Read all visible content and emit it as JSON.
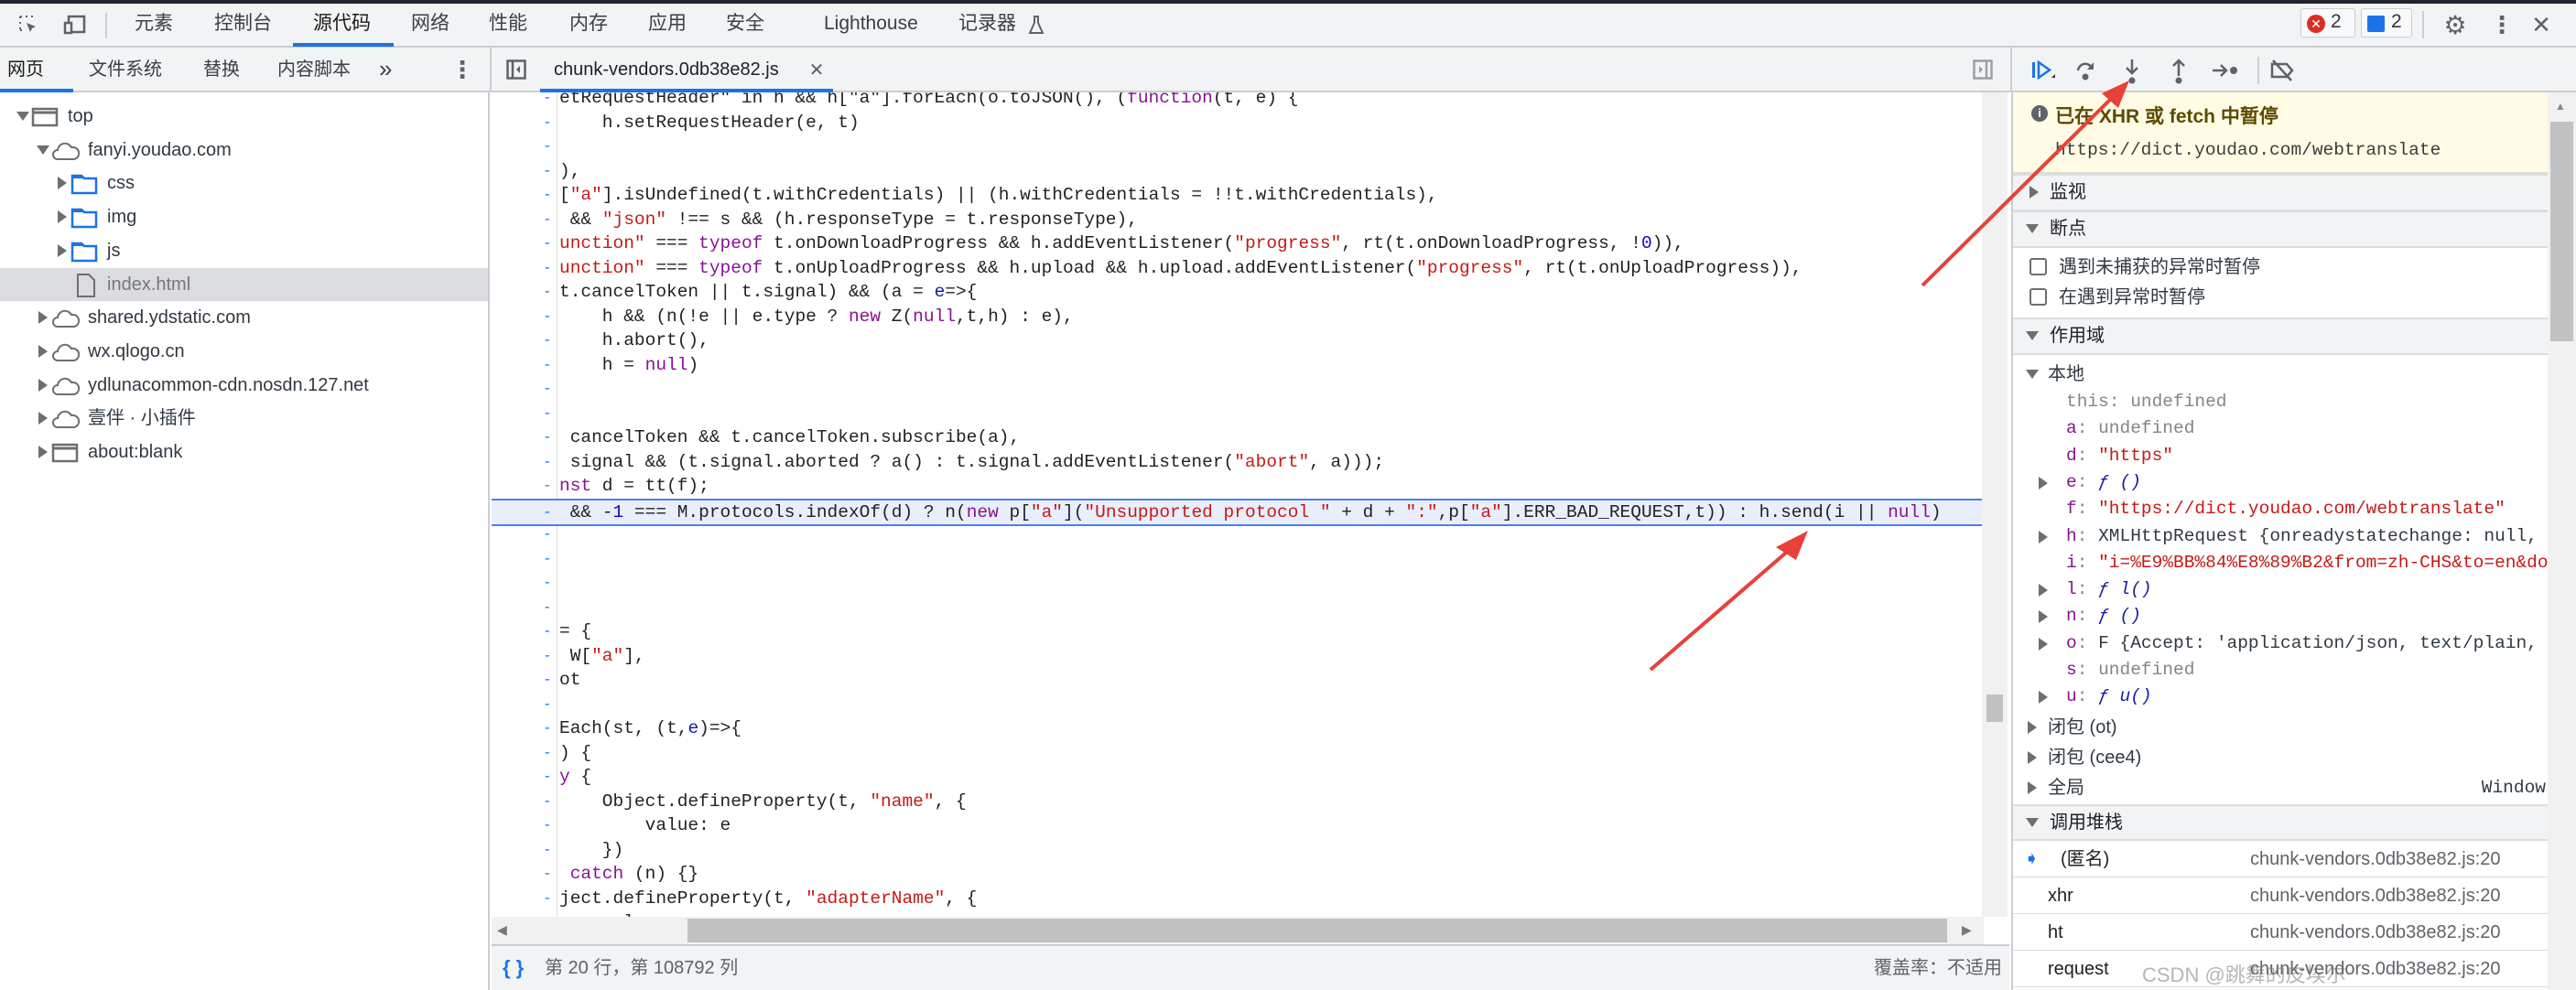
{
  "main_tabs": [
    {
      "label": "元素"
    },
    {
      "label": "控制台"
    },
    {
      "label": "源代码",
      "selected": true
    },
    {
      "label": "网络"
    },
    {
      "label": "性能"
    },
    {
      "label": "内存"
    },
    {
      "label": "应用"
    },
    {
      "label": "安全"
    },
    {
      "label": "Lighthouse"
    },
    {
      "label": "记录器"
    }
  ],
  "badges": {
    "errors": "2",
    "messages": "2",
    "error_color": "#d93025",
    "message_color": "#1a73e8"
  },
  "navigator_tabs": [
    {
      "label": "网页",
      "selected": true
    },
    {
      "label": "文件系统"
    },
    {
      "label": "替换"
    },
    {
      "label": "内容脚本"
    }
  ],
  "more_tabs": "»",
  "file_tab": {
    "name": "chunk-vendors.0db38e82.js"
  },
  "tree": [
    {
      "label": "top",
      "icon": "frame",
      "expanded": true,
      "depth": 0
    },
    {
      "label": "fanyi.youdao.com",
      "icon": "cloud",
      "expanded": true,
      "depth": 1
    },
    {
      "label": "css",
      "icon": "folder",
      "expanded": false,
      "depth": 2
    },
    {
      "label": "img",
      "icon": "folder",
      "expanded": false,
      "depth": 2
    },
    {
      "label": "js",
      "icon": "folder",
      "expanded": false,
      "depth": 2
    },
    {
      "label": "index.html",
      "icon": "file",
      "depth": 2,
      "selected": true
    },
    {
      "label": "shared.ydstatic.com",
      "icon": "cloud",
      "expanded": false,
      "depth": 1
    },
    {
      "label": "wx.qlogo.cn",
      "icon": "cloud",
      "expanded": false,
      "depth": 1
    },
    {
      "label": "ydlunacommon-cdn.nosdn.127.net",
      "icon": "cloud",
      "expanded": false,
      "depth": 1
    },
    {
      "label": "壹伴 · 小插件",
      "icon": "cloud",
      "expanded": false,
      "depth": 1
    },
    {
      "label": "about:blank",
      "icon": "frame",
      "expanded": false,
      "depth": 1
    }
  ],
  "code_lines": [
    [
      [
        "etRequestHeader\" in h && h[\"a\"].forEach(o.toJSON(), (",
        ""
      ],
      [
        "function",
        "k"
      ],
      [
        "(t, e) {",
        ""
      ]
    ],
    [
      [
        "    h.setRequestHeader(e, t)",
        ""
      ]
    ],
    [],
    [
      [
        "),",
        ""
      ]
    ],
    [
      [
        "[",
        ""
      ],
      [
        "\"a\"",
        "s"
      ],
      [
        "].isUndefined(t.withCredentials) || (h.withCredentials = !!t.withCredentials),",
        ""
      ]
    ],
    [
      [
        " && ",
        ""
      ],
      [
        "\"json\"",
        "s"
      ],
      [
        " !== s && (h.responseType = t.responseType),",
        ""
      ]
    ],
    [
      [
        "unction\"",
        "s"
      ],
      [
        " === ",
        ""
      ],
      [
        "typeof",
        "k"
      ],
      [
        " t.onDownloadProgress && h.addEventListener(",
        ""
      ],
      [
        "\"progress\"",
        "s"
      ],
      [
        ", rt(t.onDownloadProgress, !",
        ""
      ],
      [
        "0",
        "n"
      ],
      [
        ")),",
        ""
      ]
    ],
    [
      [
        "unction\"",
        "s"
      ],
      [
        " === ",
        ""
      ],
      [
        "typeof",
        "k"
      ],
      [
        " t.onUploadProgress && h.upload && h.upload.addEventListener(",
        ""
      ],
      [
        "\"progress\"",
        "s"
      ],
      [
        ", rt(t.onUploadProgress)),",
        ""
      ]
    ],
    [
      [
        "t.cancelToken || t.signal) && (a = ",
        ""
      ],
      [
        "e",
        "v"
      ],
      [
        "=>{",
        ""
      ]
    ],
    [
      [
        "    h && (n(!e || e.type ? ",
        ""
      ],
      [
        "new",
        "k"
      ],
      [
        " Z(",
        ""
      ],
      [
        "null",
        "k"
      ],
      [
        ",t,h) : e),",
        ""
      ]
    ],
    [
      [
        "    h.abort(),",
        ""
      ]
    ],
    [
      [
        "    h = ",
        ""
      ],
      [
        "null",
        "k"
      ],
      [
        ")",
        ""
      ]
    ],
    [],
    [],
    [
      [
        " cancelToken && t.cancelToken.subscribe(a),",
        ""
      ]
    ],
    [
      [
        " signal && (t.signal.aborted ? a() : t.signal.addEventListener(",
        ""
      ],
      [
        "\"abort\"",
        "s"
      ],
      [
        ", a)));",
        ""
      ]
    ],
    [
      [
        "nst",
        "k"
      ],
      [
        " d = tt(f);",
        ""
      ]
    ],
    [
      [
        " && -",
        ""
      ],
      [
        "1",
        "n"
      ],
      [
        " === M.protocols.indexOf(d) ? n(",
        ""
      ],
      [
        "new",
        "k"
      ],
      [
        " p[",
        ""
      ],
      [
        "\"a\"",
        "s"
      ],
      [
        "](",
        ""
      ],
      [
        "\"Unsupported protocol \"",
        "s"
      ],
      [
        " + d + ",
        ""
      ],
      [
        "\":\"",
        "s"
      ],
      [
        ",p[",
        ""
      ],
      [
        "\"a\"",
        "s"
      ],
      [
        "].ERR_BAD_REQUEST,t)) : h.send(i || ",
        ""
      ],
      [
        "null",
        "k"
      ],
      [
        ")",
        ""
      ]
    ],
    [],
    [],
    [],
    [],
    [
      [
        "= {",
        ""
      ]
    ],
    [
      [
        " W[",
        ""
      ],
      [
        "\"a\"",
        "s"
      ],
      [
        "],",
        ""
      ]
    ],
    [
      [
        "ot",
        ""
      ]
    ],
    [],
    [
      [
        "Each(st, (t,",
        ""
      ],
      [
        "e",
        "v"
      ],
      [
        ")=>{",
        ""
      ]
    ],
    [
      [
        ") {",
        ""
      ]
    ],
    [
      [
        "y",
        "k"
      ],
      [
        " {",
        ""
      ]
    ],
    [
      [
        "    Object.defineProperty(t, ",
        ""
      ],
      [
        "\"name\"",
        "s"
      ],
      [
        ", {",
        ""
      ]
    ],
    [
      [
        "        value: e",
        ""
      ]
    ],
    [
      [
        "    })",
        ""
      ]
    ],
    [
      [
        " ",
        ""
      ],
      [
        "catch",
        "k"
      ],
      [
        " (n) {}",
        ""
      ]
    ],
    [
      [
        "ject.defineProperty(t, ",
        ""
      ],
      [
        "\"adapterName\"",
        "s"
      ],
      [
        ", {",
        ""
      ]
    ],
    [
      [
        "    value: e",
        ""
      ]
    ]
  ],
  "highlighted_line_index": 17,
  "status": {
    "position": "第 20 行，第 108792 列",
    "coverage": "覆盖率：不适用"
  },
  "paused": {
    "title": "已在 XHR 或 fetch 中暂停",
    "url": "https://dict.youdao.com/webtranslate"
  },
  "sections": {
    "watch": "监视",
    "breakpoints": "断点",
    "scope": "作用域",
    "call_stack": "调用堆栈"
  },
  "breakpoint_options": [
    {
      "label": "遇到未捕获的异常时暂停",
      "checked": false
    },
    {
      "label": "在遇到异常时暂停",
      "checked": false
    }
  ],
  "scope": {
    "local_label": "本地",
    "vars": [
      {
        "key": "this",
        "value": "undefined",
        "type": "undef",
        "expandable": false
      },
      {
        "key": "a",
        "value": "undefined",
        "type": "undef",
        "expandable": false
      },
      {
        "key": "d",
        "value": "\"https\"",
        "type": "str",
        "expandable": false
      },
      {
        "key": "e",
        "value": "ƒ ()",
        "type": "fn",
        "expandable": true
      },
      {
        "key": "f",
        "value": "\"https://dict.youdao.com/webtranslate\"",
        "type": "str",
        "expandable": false
      },
      {
        "key": "h",
        "value": "XMLHttpRequest {onreadystatechange: null,",
        "type": "obj",
        "expandable": true
      },
      {
        "key": "i",
        "value": "\"i=%E9%BB%84%E8%89%B2&from=zh-CHS&to=en&do",
        "type": "str",
        "expandable": false
      },
      {
        "key": "l",
        "value": "ƒ l()",
        "type": "fn",
        "expandable": true
      },
      {
        "key": "n",
        "value": "ƒ ()",
        "type": "fn",
        "expandable": true
      },
      {
        "key": "o",
        "value": "F {Accept: 'application/json, text/plain,",
        "type": "obj",
        "expandable": true
      },
      {
        "key": "s",
        "value": "undefined",
        "type": "undef",
        "expandable": false
      },
      {
        "key": "u",
        "value": "ƒ u()",
        "type": "fn",
        "expandable": true
      }
    ],
    "closures": [
      {
        "label": "闭包 (ot)"
      },
      {
        "label": "闭包 (cee4)"
      }
    ],
    "global": {
      "label": "全局",
      "value": "Window"
    }
  },
  "call_stack": [
    {
      "name": "(匿名)",
      "file": "chunk-vendors.0db38e82.js:20",
      "current": true
    },
    {
      "name": "xhr",
      "file": "chunk-vendors.0db38e82.js:20"
    },
    {
      "name": "ht",
      "file": "chunk-vendors.0db38e82.js:20"
    },
    {
      "name": "request",
      "file": "chunk-vendors.0db38e82.js:20"
    }
  ],
  "watermark": "CSDN @跳舞的皮埃尔",
  "annotation_color": "#e8413a"
}
